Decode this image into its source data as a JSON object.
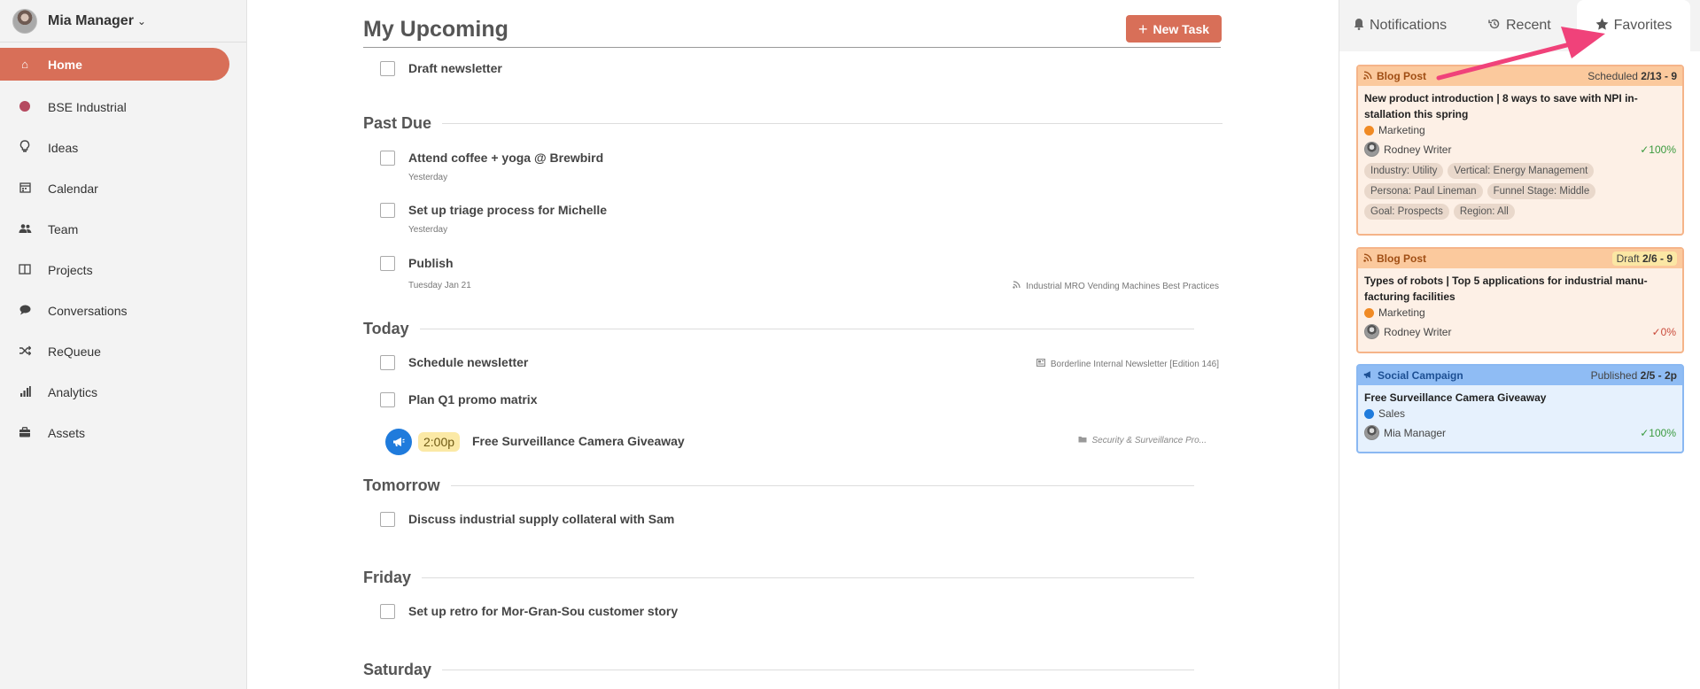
{
  "user": {
    "name": "Mia Manager"
  },
  "nav": [
    {
      "label": "Home",
      "icon": "home-icon",
      "glyph": "⌂",
      "active": true
    },
    {
      "label": "BSE Industrial",
      "icon": "workspace-dot-icon",
      "glyph": "",
      "dot_color": "#b5495f"
    },
    {
      "label": "Ideas",
      "icon": "lightbulb-icon",
      "glyph": "♁"
    },
    {
      "label": "Calendar",
      "icon": "calendar-icon",
      "glyph": "▦"
    },
    {
      "label": "Team",
      "icon": "team-icon",
      "glyph": "☻"
    },
    {
      "label": "Projects",
      "icon": "projects-icon",
      "glyph": "◫"
    },
    {
      "label": "Conversations",
      "icon": "chat-bubble-icon",
      "glyph": "●"
    },
    {
      "label": "ReQueue",
      "icon": "shuffle-icon",
      "glyph": "⤨"
    },
    {
      "label": "Analytics",
      "icon": "bar-chart-icon",
      "glyph": "▮"
    },
    {
      "label": "Assets",
      "icon": "briefcase-icon",
      "glyph": "▣"
    }
  ],
  "main": {
    "title": "My Upcoming",
    "new_task_label": "New Task",
    "tasks": {
      "draft": {
        "title": "Draft newsletter"
      },
      "coffee": {
        "title": "Attend coffee + yoga @ Brewbird",
        "sub": "Yesterday"
      },
      "triage": {
        "title": "Set up triage process for Michelle",
        "sub": "Yesterday"
      },
      "publish": {
        "title": "Publish",
        "sub": "Tuesday Jan 21",
        "link": "Industrial MRO Vending Machines Best Practices"
      },
      "schedule": {
        "title": "Schedule newsletter",
        "link": "Borderline Internal Newsletter [Edition 146]"
      },
      "promo": {
        "title": "Plan Q1 promo matrix"
      },
      "discuss": {
        "title": "Discuss industrial supply collateral with Sam"
      },
      "retro": {
        "title": "Set up retro for Mor-Gran-Sou customer story"
      }
    },
    "campaign": {
      "time": "2:00p",
      "title": "Free Surveillance Camera Giveaway",
      "link": "Security & Surveillance Pro..."
    },
    "sections": {
      "past_due": "Past Due",
      "today": "Today",
      "tomorrow": "Tomorrow",
      "friday": "Friday",
      "saturday": "Saturday"
    }
  },
  "panel": {
    "tabs": [
      {
        "label": "Notifications",
        "icon": "bell-icon",
        "glyph": "🔔"
      },
      {
        "label": "Recent",
        "icon": "history-icon",
        "glyph": "⟲"
      },
      {
        "label": "Favorites",
        "icon": "star-icon",
        "glyph": "★",
        "active": true
      }
    ],
    "cards": [
      {
        "type": "Blog Post",
        "status": "Scheduled",
        "date": "2/13 - 9",
        "title": "New product introduction | 8 ways to save with NPI in-stallation this spring",
        "tag": "Marketing",
        "tag_color": "#f08a24",
        "user": "Rodney Writer",
        "progress": "✓100%",
        "pills": [
          "Industry: Utility",
          "Vertical: Energy Management",
          "Persona: Paul Lineman",
          "Funnel Stage: Middle",
          "Goal: Prospects",
          "Region: All"
        ]
      },
      {
        "type": "Blog Post",
        "status": "Draft",
        "date": "2/6 - 9",
        "title": "Types of robots | Top 5 applications for industrial manu-facturing facilities",
        "tag": "Marketing",
        "tag_color": "#f08a24",
        "user": "Rodney Writer",
        "progress": "✓0%"
      },
      {
        "type": "Social Campaign",
        "status": "Published",
        "date": "2/5 - 2p",
        "title": "Free Surveillance Camera Giveaway",
        "tag": "Sales",
        "tag_color": "#1f7bdc",
        "user": "Mia Manager",
        "progress": "✓100%"
      }
    ]
  },
  "colors": {
    "accent": "#d86f58",
    "annotation_arrow": "#f0427a"
  }
}
